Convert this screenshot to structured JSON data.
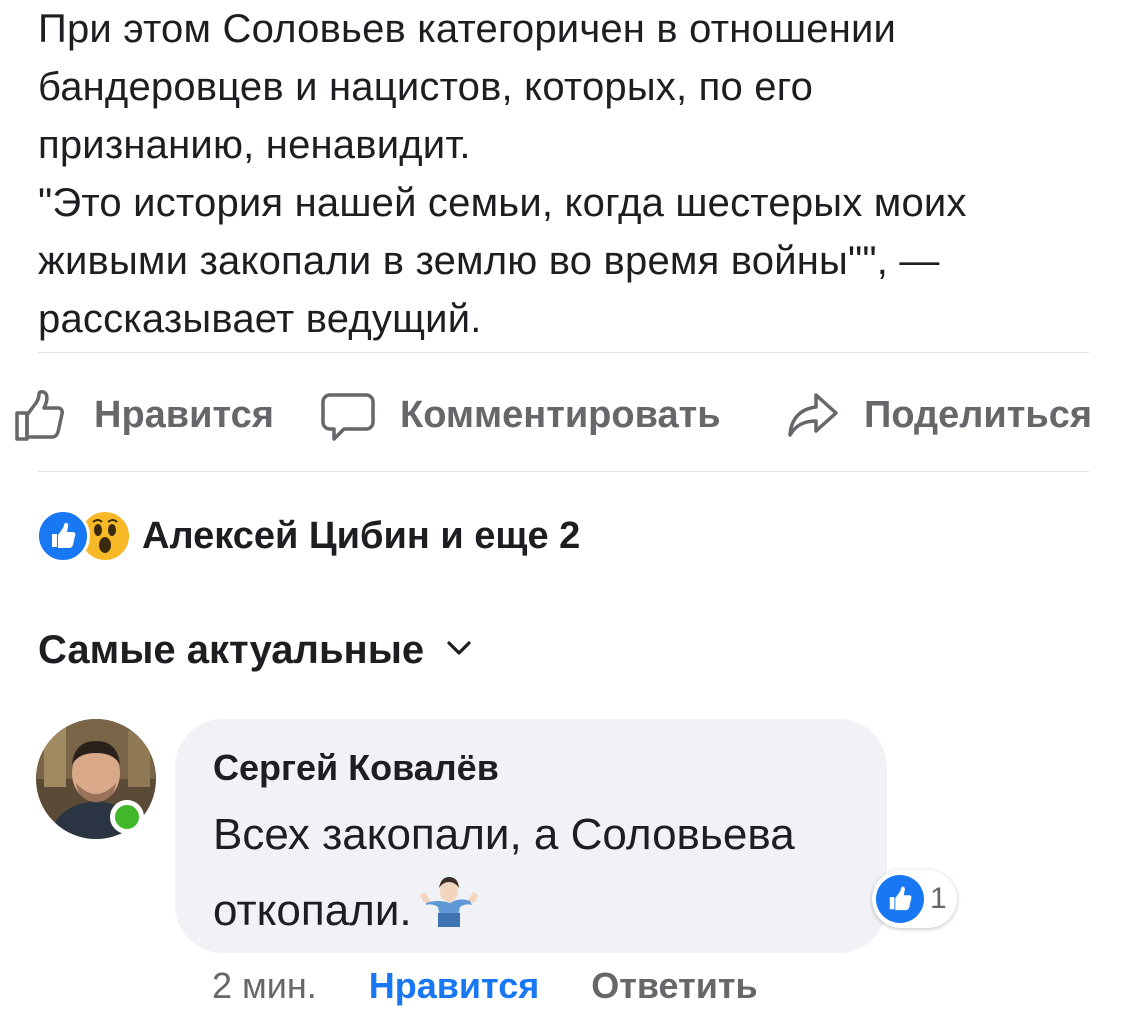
{
  "post": {
    "lines": [
      "При этом Соловьев категоричен в отношении",
      "бандеровцев и нацистов, которых, по его",
      "признанию, ненавидит.",
      "\"Это история нашей семьи, когда шестерых моих",
      "живыми закопали в землю во время войны\"\", —",
      "рассказывает ведущий."
    ]
  },
  "actions": {
    "like_label": "Нравится",
    "comment_label": "Комментировать",
    "share_label": "Поделиться"
  },
  "reactions": {
    "summary": "Алексей Цибин и еще 2",
    "icons": [
      "like-icon",
      "wow-icon"
    ]
  },
  "comments_sort": {
    "label": "Самые актуальные"
  },
  "comment": {
    "author": "Сергей Ковалёв",
    "text_line1": "Всех закопали, а Соловьева",
    "text_line2": "откопали.",
    "emoji": "shrug-emoji",
    "like_count": "1",
    "time": "2 мин.",
    "like_label": "Нравится",
    "reply_label": "Ответить",
    "online": true
  },
  "colors": {
    "accent": "#1877f2",
    "text": "#1c1e21",
    "secondary": "#65676b",
    "bubble": "#f0f2f5",
    "online": "#42b72a"
  }
}
